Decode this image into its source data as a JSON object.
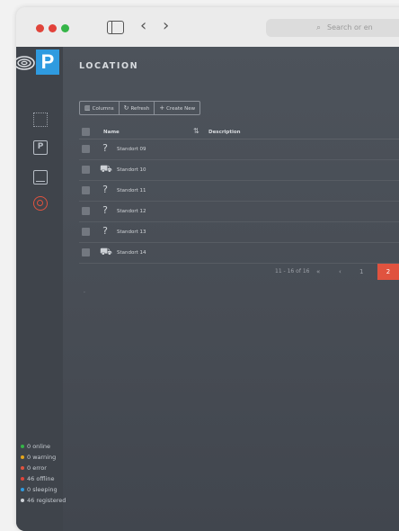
{
  "browser": {
    "search_placeholder": "Search or en",
    "icons": [
      "sidebar-toggle-icon",
      "back-icon",
      "forward-icon",
      "search-icon"
    ]
  },
  "app": {
    "logo_letter": "P",
    "page_title": "LOCATION",
    "accent_color": "#e0533f",
    "brand_color": "#2f9be0"
  },
  "sidebar": {
    "items": [
      {
        "name": "dashboard-grid-icon"
      },
      {
        "name": "parking-icon",
        "glyph": "P"
      },
      {
        "name": "tablet-icon"
      },
      {
        "name": "location-target-icon",
        "active": true
      }
    ]
  },
  "toolbar": {
    "columns_label": "Columns",
    "refresh_label": "Refresh",
    "create_label": "Create New"
  },
  "table": {
    "headers": {
      "name": "Name",
      "sort_icon": "⇅",
      "description": "Description"
    },
    "rows": [
      {
        "icon": "?",
        "name": "Standort 09"
      },
      {
        "icon": "⛟",
        "name": "Standort 10"
      },
      {
        "icon": "?",
        "name": "Standort 11"
      },
      {
        "icon": "?",
        "name": "Standort 12"
      },
      {
        "icon": "?",
        "name": "Standort 13"
      },
      {
        "icon": "⛟",
        "name": "Standort 14"
      }
    ]
  },
  "pagination": {
    "range": "11 - 16 of 16",
    "first": "«",
    "prev": "‹",
    "page1": "1",
    "page2": "2",
    "current": 2
  },
  "status": [
    {
      "label": "0 online",
      "color": "#35b548"
    },
    {
      "label": "0 warning",
      "color": "#e5a51b"
    },
    {
      "label": "0 error",
      "color": "#e0533f"
    },
    {
      "label": "46 offline",
      "color": "#e0443a"
    },
    {
      "label": "0 sleeping",
      "color": "#2f9be0"
    },
    {
      "label": "46 registered",
      "color": "#cfd3d8"
    }
  ]
}
